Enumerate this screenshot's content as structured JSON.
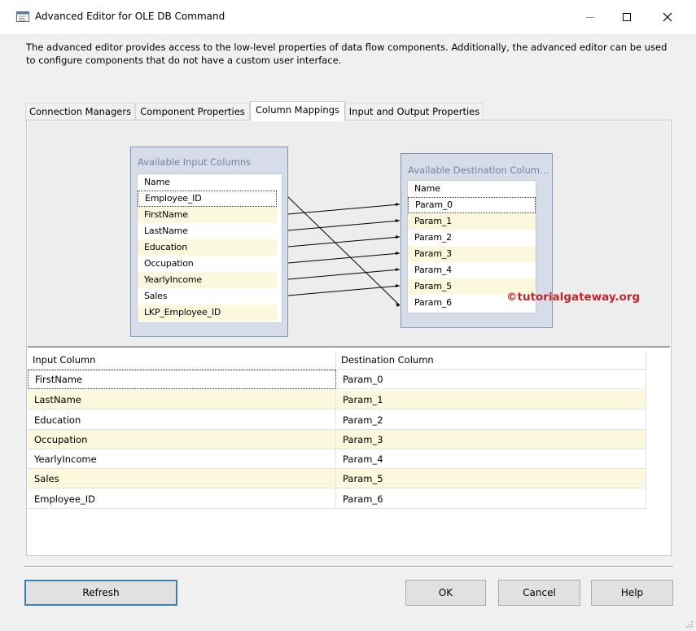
{
  "window": {
    "title": "Advanced Editor for OLE DB Command",
    "description": "The advanced editor provides access to the low-level properties of data flow components. Additionally, the advanced editor can be used to configure components that do not have a custom user interface."
  },
  "tabs": [
    {
      "label": "Connection Managers"
    },
    {
      "label": "Component Properties"
    },
    {
      "label": "Column Mappings"
    },
    {
      "label": "Input and Output Properties"
    }
  ],
  "input_columns": {
    "title": "Available Input Columns",
    "header": "Name",
    "items": [
      "Employee_ID",
      "FirstName",
      "LastName",
      "Education",
      "Occupation",
      "YearlyIncome",
      "Sales",
      "LKP_Employee_ID"
    ]
  },
  "destination_columns": {
    "title": "Available Destination Colum...",
    "header": "Name",
    "items": [
      "Param_0",
      "Param_1",
      "Param_2",
      "Param_3",
      "Param_4",
      "Param_5",
      "Param_6"
    ]
  },
  "watermark": "©tutorialgateway.org",
  "mapping_table": {
    "headers": [
      "Input Column",
      "Destination Column"
    ],
    "rows": [
      [
        "FirstName",
        "Param_0"
      ],
      [
        "LastName",
        "Param_1"
      ],
      [
        "Education",
        "Param_2"
      ],
      [
        "Occupation",
        "Param_3"
      ],
      [
        "YearlyIncome",
        "Param_4"
      ],
      [
        "Sales",
        "Param_5"
      ],
      [
        "Employee_ID",
        "Param_6"
      ]
    ]
  },
  "buttons": {
    "refresh": "Refresh",
    "ok": "OK",
    "cancel": "Cancel",
    "help": "Help"
  },
  "colors": {
    "row_highlight": "#fbf8dd",
    "column_box": "#d6dde8",
    "default_button_border": "#3c7fb1",
    "watermark": "#c0262a"
  },
  "icons": {
    "app": "editor-icon",
    "minimize": "minimize-icon",
    "maximize": "maximize-icon",
    "close": "close-icon",
    "resize": "resize-grip-icon"
  }
}
